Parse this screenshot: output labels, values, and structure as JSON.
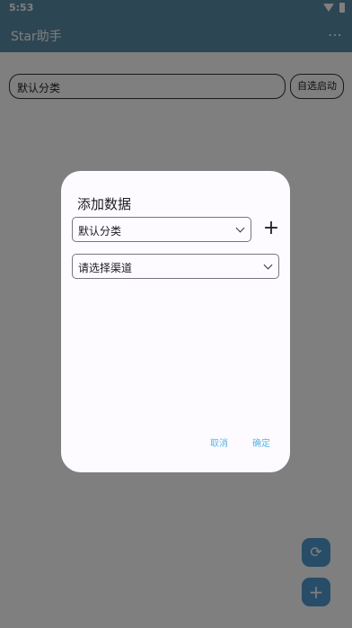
{
  "status_bar": {
    "time": "5:53"
  },
  "app_bar": {
    "title": "Star助手",
    "menu_glyph": "⋯"
  },
  "main": {
    "category_value": "默认分类",
    "auto_start_label": "自选启动"
  },
  "fabs": {
    "refresh_glyph": "⟳",
    "add_glyph": "+"
  },
  "dialog": {
    "title": "添加数据",
    "category_value": "默认分类",
    "add_glyph": "+",
    "channel_placeholder": "请选择渠道",
    "cancel_label": "取消",
    "confirm_label": "确定"
  },
  "colors": {
    "app_bar": "#5a8ca7",
    "fab": "#4f9bd0",
    "action_text": "#59b4e8",
    "scrim": "rgba(0,0,0,0.5)"
  }
}
